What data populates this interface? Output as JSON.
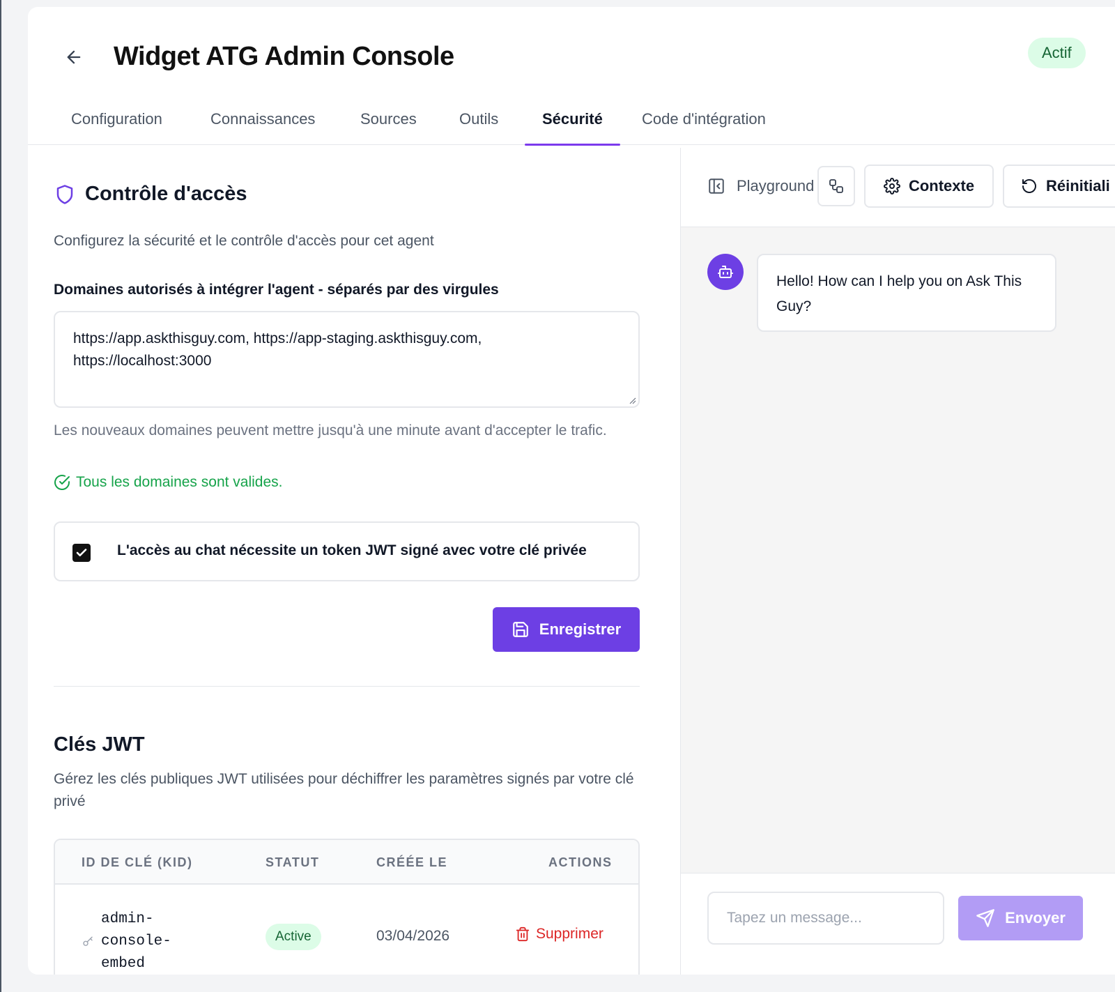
{
  "header": {
    "title": "Widget ATG Admin Console",
    "status": "Actif"
  },
  "tabs": [
    {
      "label": "Configuration",
      "active": false
    },
    {
      "label": "Connaissances",
      "active": false
    },
    {
      "label": "Sources",
      "active": false
    },
    {
      "label": "Outils",
      "active": false
    },
    {
      "label": "Sécurité",
      "active": true
    },
    {
      "label": "Code d'intégration",
      "active": false
    }
  ],
  "access": {
    "title": "Contrôle d'accès",
    "description": "Configurez la sécurité et le contrôle d'accès pour cet agent",
    "domains_label": "Domaines autorisés à intégrer l'agent - séparés par des virgules",
    "domains_value": "https://app.askthisguy.com, https://app-staging.askthisguy.com,\nhttps://localhost:3000",
    "help": "Les nouveaux domaines peuvent mettre jusqu'à une minute avant d'accepter le trafic.",
    "valid_message": "Tous les domaines sont valides.",
    "jwt_required_label": "L'accès au chat nécessite un token JWT signé avec votre clé privée",
    "jwt_required_checked": true,
    "save_label": "Enregistrer"
  },
  "keys": {
    "title": "Clés JWT",
    "description": "Gérez les clés publiques JWT utilisées pour déchiffrer les paramètres signés par votre clé privé",
    "columns": [
      "ID DE CLÉ (KID)",
      "STATUT",
      "CRÉÉE LE",
      "ACTIONS"
    ],
    "rows": [
      {
        "kid": "admin-console-embed",
        "status": "Active",
        "created": "03/04/2026",
        "action": "Supprimer"
      }
    ]
  },
  "playground": {
    "label": "Playground",
    "context_label": "Contexte",
    "reset_label": "Réinitiali",
    "bot_message": "Hello! How can I help you on Ask This Guy?",
    "input_placeholder": "Tapez un message...",
    "send_label": "Envoyer"
  },
  "colors": {
    "accent": "#6d3fe4",
    "success": "#16a34a",
    "danger": "#dc2626",
    "send_disabled": "#b29cf5"
  },
  "icons": {
    "back": "arrow-left-icon",
    "shield": "shield-icon",
    "valid": "check-circle-icon",
    "save": "floppy-disk-icon",
    "key": "key-icon",
    "delete": "trash-icon",
    "panel": "panel-collapse-icon",
    "swap": "workflow-icon",
    "settings": "gear-icon",
    "reset": "rotate-ccw-icon",
    "bot": "bot-icon",
    "send": "send-icon"
  }
}
